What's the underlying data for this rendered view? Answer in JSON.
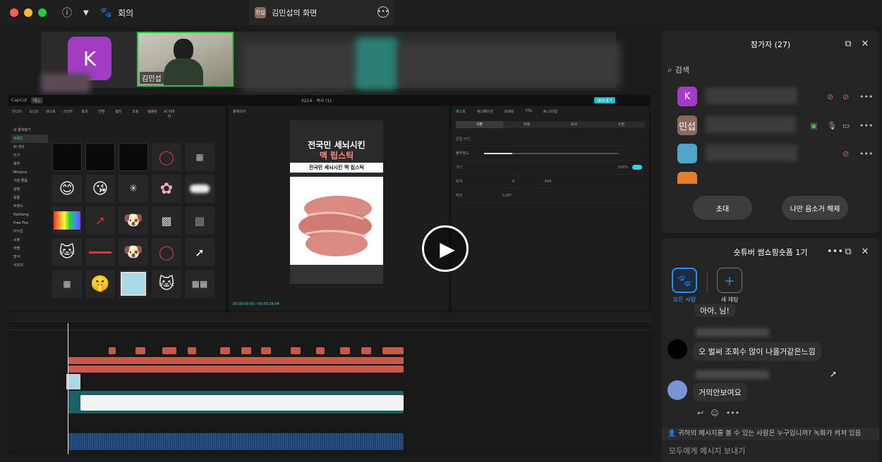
{
  "topbar": {
    "meeting_label": "회의",
    "share_badge": "민섭",
    "share_title": "김민섭의 화면"
  },
  "video_strip": {
    "tiles": [
      {
        "initial": "K",
        "color": "#a23cc5"
      },
      {
        "name": "김민섭",
        "active_border": "#27c23f"
      }
    ]
  },
  "editor": {
    "app_name": "CapCut",
    "badge": "메뉴",
    "center_title": "0214 - 복사 (1)",
    "export_label": "내보내기",
    "left_tools": [
      "미디어",
      "오디오",
      "텍스트",
      "스티커",
      "효과",
      "전환",
      "필터",
      "조정",
      "템플릿",
      "AI 아바타"
    ],
    "categories": [
      "내 즐겨찾기",
      "트렌드",
      "AI 생성",
      "인기",
      "축하",
      "Minions",
      "기분 좋음",
      "감정",
      "동물",
      "트렌드",
      "Nailsong",
      "Free Fire",
      "아이콘",
      "쇼핑",
      "라벨",
      "장식",
      "이모지"
    ],
    "preview_label": "플레이어",
    "preview_headline_1": "전국민 세뇌시킨",
    "preview_headline_2": "맥 립스틱",
    "preview_caption": "전국민 세뇌시킨 맥 립스틱",
    "preview_time": "00:00:00:00 / 00:00:29:04",
    "right_tabs": [
      "텍스트",
      "애니메이션",
      "트래킹",
      "TTS",
      "AI 스타일"
    ],
    "right_subtabs": [
      "기본",
      "버블",
      "효과",
      "조명"
    ],
    "right_rows": [
      "균일 크기",
      "불투명도",
      "위치",
      "회전",
      "크기"
    ],
    "scale_value": "100%",
    "pos_x": "0",
    "pos_y": "-493",
    "rotate_value": "0.00°"
  },
  "participants": {
    "title": "참가자 (27)",
    "search_placeholder": "검색",
    "rows": [
      {
        "avatar": "K",
        "color": "#a23cc5"
      },
      {
        "avatar": "민섭",
        "color": "#8a6a5c"
      },
      {
        "avatar": "",
        "color": "#4fa6c9"
      },
      {
        "avatar": "",
        "color": "#e57c2a"
      }
    ],
    "invite_label": "초대",
    "unmute_label": "나만 음소거 해제"
  },
  "chat": {
    "title": "숏튜버 썸쇼핑숏폼 1기",
    "options": [
      {
        "label": "모든 사람",
        "icon": "paw-icon"
      },
      {
        "label": "새 채팅",
        "icon": "plus-icon"
      }
    ],
    "messages": [
      {
        "text": "아아, 님!"
      },
      {
        "text": "오 벌써 조회수 많이 나올거같은느낌"
      },
      {
        "text": "거의안보여요"
      }
    ],
    "notice": "귀하의 메시지를 볼 수 있는 사람은 누구입니까? 녹화가 켜져 있음",
    "input_placeholder": "모두에게 메시지 보내기"
  }
}
